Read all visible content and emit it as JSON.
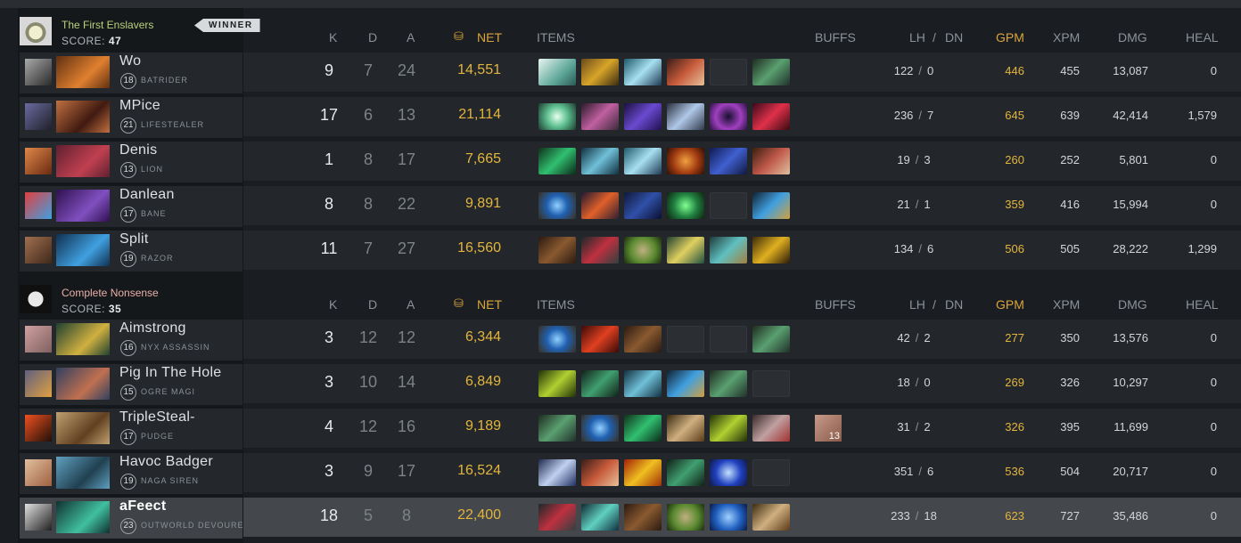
{
  "columns": {
    "k": "K",
    "d": "D",
    "a": "A",
    "net": "NET",
    "items": "ITEMS",
    "buffs": "BUFFS",
    "lh": "LH",
    "sep": "/",
    "dn": "DN",
    "gpm": "GPM",
    "xpm": "XPM",
    "dmg": "DMG",
    "heal": "HEAL"
  },
  "colors": {
    "radiant": "#b9d07a",
    "dire": "#e8b0a8",
    "gold": "#e3b53c"
  },
  "teams": [
    {
      "name": "The First Enslavers",
      "score_label": "SCORE:",
      "score": "47",
      "badge": "WINNER",
      "players": [
        {
          "name": "Wo",
          "level": "18",
          "hero": "BATRIDER",
          "k": "9",
          "d": "7",
          "a": "24",
          "net": "14,551",
          "lh": "122",
          "dn": "0",
          "gpm": "446",
          "xpm": "455",
          "dmg": "13,087",
          "heal": "0",
          "items": [
            "wind-icon",
            "gold-helm-icon",
            "ice-icon",
            "red-cloak-icon",
            "empty",
            "green-staff-icon"
          ]
        },
        {
          "name": "MPice",
          "level": "21",
          "hero": "LIFESTEALER",
          "k": "17",
          "d": "6",
          "a": "13",
          "net": "21,114",
          "lh": "236",
          "dn": "7",
          "gpm": "645",
          "xpm": "639",
          "dmg": "42,414",
          "heal": "1,579",
          "items": [
            "glow-icon",
            "pink-wings-icon",
            "purple-claw-icon",
            "blue-sword-icon",
            "purple-ring-icon",
            "red-sickle-icon"
          ]
        },
        {
          "name": "Denis",
          "level": "13",
          "hero": "LION",
          "k": "1",
          "d": "8",
          "a": "17",
          "net": "7,665",
          "lh": "19",
          "dn": "3",
          "gpm": "260",
          "xpm": "252",
          "dmg": "5,801",
          "heal": "0",
          "items": [
            "green-boots-icon",
            "wave-icon",
            "ice-icon",
            "orange-orb-icon",
            "blue-robe-icon",
            "axe-icon"
          ]
        },
        {
          "name": "Danlean",
          "level": "17",
          "hero": "BANE",
          "k": "8",
          "d": "8",
          "a": "22",
          "net": "9,891",
          "lh": "21",
          "dn": "1",
          "gpm": "359",
          "xpm": "416",
          "dmg": "15,994",
          "heal": "0",
          "items": [
            "blue-amulet-icon",
            "fire-staff-icon",
            "blue-cape-icon",
            "green-gem-icon",
            "empty",
            "blue-bottle-icon"
          ]
        },
        {
          "name": "Split",
          "level": "19",
          "hero": "RAZOR",
          "k": "11",
          "d": "7",
          "a": "27",
          "net": "16,560",
          "lh": "134",
          "dn": "6",
          "gpm": "506",
          "xpm": "505",
          "dmg": "28,222",
          "heal": "1,299",
          "items": [
            "brown-boots-icon",
            "red-blade-icon",
            "green-bowl-icon",
            "yellow-wand-icon",
            "teal-bracer-icon",
            "yellow-claw-icon"
          ]
        }
      ]
    },
    {
      "name": "Complete Nonsense",
      "score_label": "SCORE:",
      "score": "35",
      "players": [
        {
          "name": "Aimstrong",
          "level": "16",
          "hero": "NYX ASSASSIN",
          "k": "3",
          "d": "12",
          "a": "12",
          "net": "6,344",
          "lh": "42",
          "dn": "2",
          "gpm": "277",
          "xpm": "350",
          "dmg": "13,576",
          "heal": "0",
          "items": [
            "blue-amulet-icon",
            "red-spear-icon",
            "brown-boots-icon",
            "empty",
            "empty",
            "green-staff-icon"
          ]
        },
        {
          "name": "Pig In The Hole",
          "level": "15",
          "hero": "OGRE MAGI",
          "k": "3",
          "d": "10",
          "a": "14",
          "net": "6,849",
          "lh": "18",
          "dn": "0",
          "gpm": "269",
          "xpm": "326",
          "dmg": "10,297",
          "heal": "0",
          "items": [
            "lime-trident-icon",
            "green-branch-icon",
            "wave-icon",
            "blue-bottle-icon",
            "green-staff-icon",
            "empty"
          ]
        },
        {
          "name": "TripleSteal-",
          "level": "17",
          "hero": "PUDGE",
          "k": "4",
          "d": "12",
          "a": "16",
          "net": "9,189",
          "lh": "31",
          "dn": "2",
          "gpm": "326",
          "xpm": "395",
          "dmg": "11,699",
          "heal": "0",
          "buff": "13",
          "items": [
            "green-staff-icon",
            "blue-amulet-icon",
            "green-boots-icon",
            "scroll-icon",
            "lime-trident-icon",
            "armor-icon"
          ]
        },
        {
          "name": "Havoc Badger",
          "level": "19",
          "hero": "NAGA SIREN",
          "k": "3",
          "d": "9",
          "a": "17",
          "net": "16,524",
          "lh": "351",
          "dn": "6",
          "gpm": "536",
          "xpm": "504",
          "dmg": "20,717",
          "heal": "0",
          "items": [
            "blue-axe-icon",
            "red-cloak-icon",
            "flame-sword-icon",
            "green-branch-icon",
            "blue-orb-icon",
            "empty"
          ]
        },
        {
          "name": "aFeect",
          "level": "23",
          "hero": "OUTWORLD DEVOURER",
          "k": "18",
          "d": "5",
          "a": "8",
          "net": "22,400",
          "lh": "233",
          "dn": "18",
          "gpm": "623",
          "xpm": "727",
          "dmg": "35,486",
          "heal": "0",
          "items": [
            "red-blade-icon",
            "teal-bow-icon",
            "brown-boots-icon",
            "green-bowl-icon",
            "blue-aura-icon",
            "scroll-icon"
          ]
        }
      ]
    }
  ]
}
